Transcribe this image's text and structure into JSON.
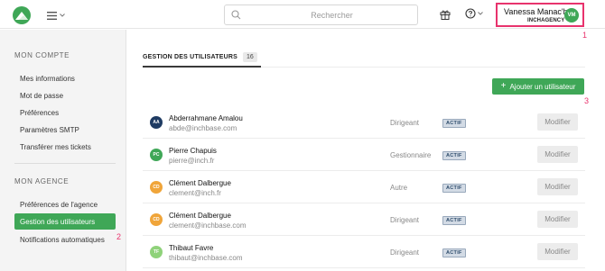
{
  "colors": {
    "accent": "#3fa757",
    "annotation": "#e8336d",
    "status_bg": "#d3dbe5"
  },
  "header": {
    "logo_icon": "mountain-logo-icon",
    "menu_icon": "hamburger-menu-icon",
    "search": {
      "placeholder": "Rechercher",
      "value": ""
    },
    "gift_icon": "gift-icon",
    "help_icon": "help-circle-icon",
    "user": {
      "name": "Vanessa Manac'h",
      "org": "INCHAGENCY",
      "initials": "VM"
    }
  },
  "annotations": {
    "a1": "1",
    "a2": "2",
    "a3": "3"
  },
  "sidebar": {
    "section1": "MON COMPTE",
    "account_items": [
      {
        "label": "Mes informations"
      },
      {
        "label": "Mot de passe"
      },
      {
        "label": "Préférences"
      },
      {
        "label": "Paramètres SMTP"
      },
      {
        "label": "Transférer mes tickets"
      }
    ],
    "section2": "MON AGENCE",
    "agency_items": [
      {
        "label": "Préférences de l'agence"
      },
      {
        "label": "Gestion des utilisateurs",
        "active": true
      },
      {
        "label": "Notifications automatiques"
      }
    ]
  },
  "main": {
    "tab": {
      "label": "GESTION DES UTILISATEURS",
      "count": "16"
    },
    "add_button": "Ajouter un utilisateur",
    "users": [
      {
        "initials": "AA",
        "avatar_color": "#1f3b63",
        "name": "Abderrahmane Amalou",
        "email": "abde@inchbase.com",
        "role": "Dirigeant",
        "status": "ACTIF",
        "action": "Modifier"
      },
      {
        "initials": "PC",
        "avatar_color": "#3fa757",
        "name": "Pierre Chapuis",
        "email": "pierre@inch.fr",
        "role": "Gestionnaire",
        "status": "ACTIF",
        "action": "Modifier"
      },
      {
        "initials": "CD",
        "avatar_color": "#f0a53a",
        "name": "Clément Dalbergue",
        "email": "clement@inch.fr",
        "role": "Autre",
        "status": "ACTIF",
        "action": "Modifier"
      },
      {
        "initials": "CD",
        "avatar_color": "#f0a53a",
        "name": "Clément Dalbergue",
        "email": "clement@inchbase.com",
        "role": "Dirigeant",
        "status": "ACTIF",
        "action": "Modifier"
      },
      {
        "initials": "TF",
        "avatar_color": "#8fd27a",
        "name": "Thibaut Favre",
        "email": "thibaut@inchbase.com",
        "role": "Dirigeant",
        "status": "ACTIF",
        "action": "Modifier"
      }
    ]
  }
}
